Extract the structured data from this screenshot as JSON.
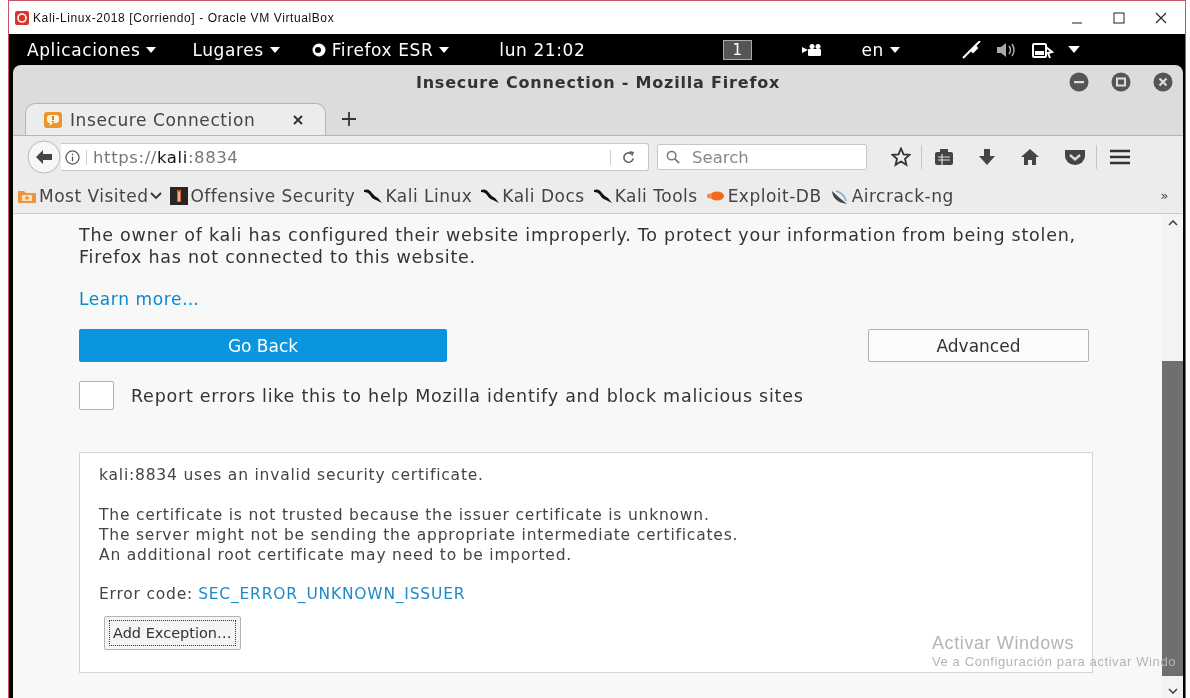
{
  "host_window": {
    "title": "Kali-Linux-2018 [Corriendo] - Oracle VM VirtualBox"
  },
  "top_bar": {
    "menus": [
      {
        "label": "Aplicaciones",
        "kind": "plain"
      },
      {
        "label": "Lugares",
        "kind": "plain"
      },
      {
        "label": "Firefox ESR",
        "kind": "app"
      }
    ],
    "clock": "lun 21:02",
    "workspace": "1",
    "language": "en"
  },
  "browser_window": {
    "title": "Insecure Connection - Mozilla Firefox"
  },
  "tabs": [
    {
      "label": "Insecure Connection",
      "selected": true
    }
  ],
  "address_bar": {
    "url": "https://**kali**:8834"
  },
  "search": {
    "placeholder": "Search"
  },
  "bookmarks": [
    {
      "label": "Most Visited",
      "kind": "folder"
    },
    {
      "label": "Offensive Security",
      "kind": "offsec"
    },
    {
      "label": "Kali Linux",
      "kind": "kali"
    },
    {
      "label": "Kali Docs",
      "kind": "kali"
    },
    {
      "label": "Kali Tools",
      "kind": "kali"
    },
    {
      "label": "Exploit-DB",
      "kind": "exploit"
    },
    {
      "label": "Aircrack-ng",
      "kind": "aircrack"
    }
  ],
  "bookmarks_overflow": "»",
  "error_page": {
    "message": "The owner of kali has configured their website improperly. To protect your information from being stolen, Firefox has not connected to this website.",
    "learn_more": "Learn more…",
    "go_back": "Go Back",
    "advanced": "Advanced",
    "report": {
      "label": "Report errors like this to help Mozilla identify and block malicious sites",
      "checked": false
    },
    "details": {
      "summary": "kali:8834 uses an invalid security certificate.",
      "lines": [
        "The certificate is not trusted because the issuer certificate is unknown.",
        "The server might not be sending the appropriate intermediate certificates.",
        "An additional root certificate may need to be imported."
      ],
      "error_label": "Error code:",
      "error_code": "SEC_ERROR_UNKNOWN_ISSUER",
      "add_exception": "Add Exception…"
    }
  },
  "watermark": {
    "title": "Activar Windows",
    "subtitle": "Ve a Configuración para activar Windo"
  }
}
